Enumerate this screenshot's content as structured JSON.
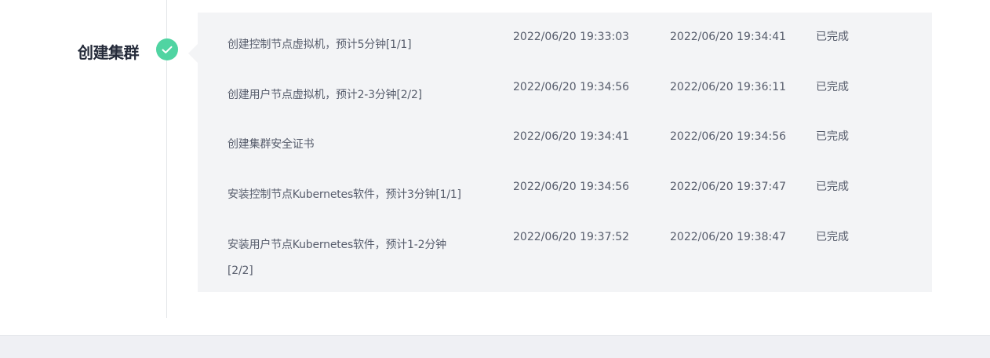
{
  "stage": {
    "title": "创建集群",
    "icon": "check-icon",
    "dot_color": "#50d4a2"
  },
  "tasks": [
    {
      "name_lines": [
        "创建控制节点虚拟机，预计5分钟[1/1]"
      ],
      "start": "2022/06/20 19:33:03",
      "end": "2022/06/20 19:34:41",
      "status": "已完成"
    },
    {
      "name_lines": [
        "创建用户节点虚拟机，预计2-3分钟[2/2]"
      ],
      "start": "2022/06/20 19:34:56",
      "end": "2022/06/20 19:36:11",
      "status": "已完成"
    },
    {
      "name_lines": [
        "创建集群安全证书"
      ],
      "start": "2022/06/20 19:34:41",
      "end": "2022/06/20 19:34:56",
      "status": "已完成"
    },
    {
      "name_lines": [
        "安装控制节点Kubernetes软件，预计3分钟[1/1]"
      ],
      "start": "2022/06/20 19:34:56",
      "end": "2022/06/20 19:37:47",
      "status": "已完成"
    },
    {
      "name_lines": [
        "安装用户节点Kubernetes软件，预计1-2分钟",
        "[2/2]"
      ],
      "start": "2022/06/20 19:37:52",
      "end": "2022/06/20 19:38:47",
      "status": "已完成"
    }
  ]
}
